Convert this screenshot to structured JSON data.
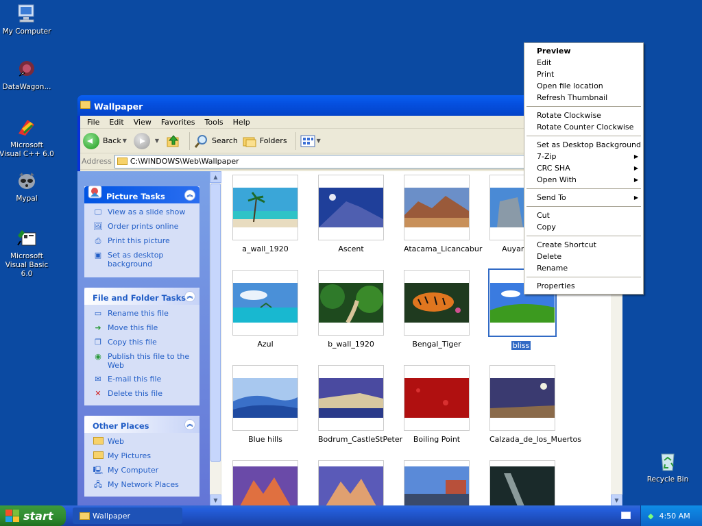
{
  "desktop": {
    "icons": [
      {
        "label": "My Computer"
      },
      {
        "label": "DataWagon..."
      },
      {
        "label": "Microsoft Visual C++ 6.0"
      },
      {
        "label": "Mypal"
      },
      {
        "label": "Microsoft Visual Basic 6.0"
      },
      {
        "label": "Recycle Bin"
      }
    ]
  },
  "window": {
    "title": "Wallpaper",
    "menu": [
      "File",
      "Edit",
      "View",
      "Favorites",
      "Tools",
      "Help"
    ],
    "toolbar": {
      "back": "Back",
      "search": "Search",
      "folders": "Folders"
    },
    "address": {
      "label": "Address",
      "value": "C:\\WINDOWS\\Web\\Wallpaper"
    }
  },
  "taskpane": {
    "picture_tasks": {
      "title": "Picture Tasks",
      "items": [
        "View as a slide show",
        "Order prints online",
        "Print this picture",
        "Set as desktop background"
      ]
    },
    "file_tasks": {
      "title": "File and Folder Tasks",
      "items": [
        "Rename this file",
        "Move this file",
        "Copy this file",
        "Publish this file to the Web",
        "E-mail this file",
        "Delete this file"
      ]
    },
    "other_places": {
      "title": "Other Places",
      "items": [
        "Web",
        "My Pictures",
        "My Computer",
        "My Network Places"
      ]
    }
  },
  "thumbnails": [
    {
      "name": "a_wall_1920"
    },
    {
      "name": "Ascent"
    },
    {
      "name": "Atacama_Licancabur"
    },
    {
      "name": "Auyantepu"
    },
    {
      "name": "Azul"
    },
    {
      "name": "b_wall_1920"
    },
    {
      "name": "Bengal_Tiger"
    },
    {
      "name": "bliss",
      "selected": true
    },
    {
      "name": "Blue hills"
    },
    {
      "name": "Bodrum_CastleStPeter"
    },
    {
      "name": "Boiling Point"
    },
    {
      "name": "Calzada_de_los_Muertos"
    }
  ],
  "context_menu": {
    "preview": "Preview",
    "edit": "Edit",
    "print": "Print",
    "open_location": "Open file location",
    "refresh": "Refresh Thumbnail",
    "rotate_cw": "Rotate Clockwise",
    "rotate_ccw": "Rotate Counter Clockwise",
    "set_bg": "Set as Desktop Background",
    "zip": "7-Zip",
    "crc": "CRC SHA",
    "open_with": "Open With",
    "send_to": "Send To",
    "cut": "Cut",
    "copy": "Copy",
    "shortcut": "Create Shortcut",
    "delete": "Delete",
    "rename": "Rename",
    "properties": "Properties"
  },
  "taskbar": {
    "start": "start",
    "task": "Wallpaper",
    "clock": "4:50 AM"
  },
  "colors": {
    "desktop": "#0b4aa2",
    "title": "#0550e0",
    "accent": "#215dc6",
    "selection": "#316ac5"
  }
}
